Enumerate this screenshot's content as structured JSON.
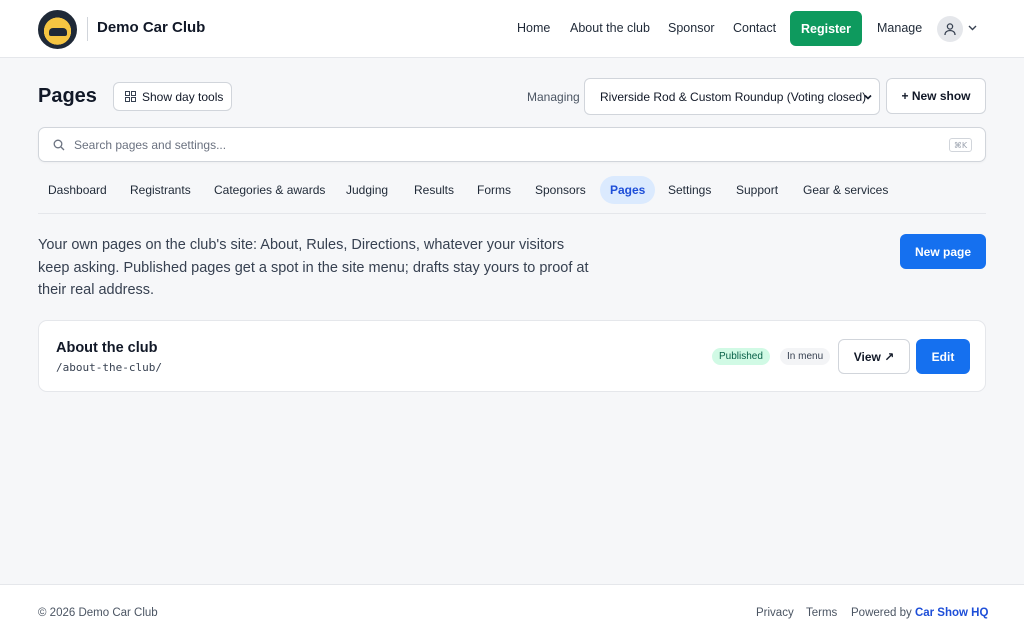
{
  "header": {
    "brand_name": "Demo Car Club",
    "nav": [
      "Home",
      "About the club",
      "Sponsor",
      "Contact"
    ],
    "register_label": "Register",
    "manage_label": "Manage"
  },
  "toolbar": {
    "title": "Pages",
    "day_tools_label": "Show day tools",
    "managing_label": "Managing",
    "selected_show": "Riverside Rod & Custom Roundup (Voting closed)",
    "new_show_label": "+ New show"
  },
  "search": {
    "placeholder": "Search pages and settings...",
    "shortcut": "⌘K"
  },
  "tabs": [
    {
      "label": "Dashboard",
      "active": false
    },
    {
      "label": "Registrants",
      "active": false
    },
    {
      "label": "Categories & awards",
      "active": false
    },
    {
      "label": "Judging",
      "active": false
    },
    {
      "label": "Results",
      "active": false
    },
    {
      "label": "Forms",
      "active": false
    },
    {
      "label": "Sponsors",
      "active": false
    },
    {
      "label": "Pages",
      "active": true
    },
    {
      "label": "Settings",
      "active": false
    },
    {
      "label": "Support",
      "active": false
    },
    {
      "label": "Gear & services",
      "active": false
    }
  ],
  "intro": {
    "text": "Your own pages on the club's site: About, Rules, Directions, whatever your visitors keep asking. Published pages get a spot in the site menu; drafts stay yours to proof at their real address.",
    "new_page_label": "New page"
  },
  "pages": [
    {
      "title": "About the club",
      "path": "/about-the-club/",
      "status": "Published",
      "menu_badge": "In menu",
      "view_label": "View ↗",
      "edit_label": "Edit"
    }
  ],
  "footer": {
    "copyright": "© 2026 Demo Car Club",
    "privacy": "Privacy",
    "terms": "Terms",
    "powered_prefix": "Powered by",
    "powered_brand": "Car Show HQ"
  },
  "colors": {
    "register": "#0e9a5e",
    "primary": "#1570ef",
    "active_tab_bg": "#dbeafe",
    "published_badge_bg": "#d1fae5"
  }
}
